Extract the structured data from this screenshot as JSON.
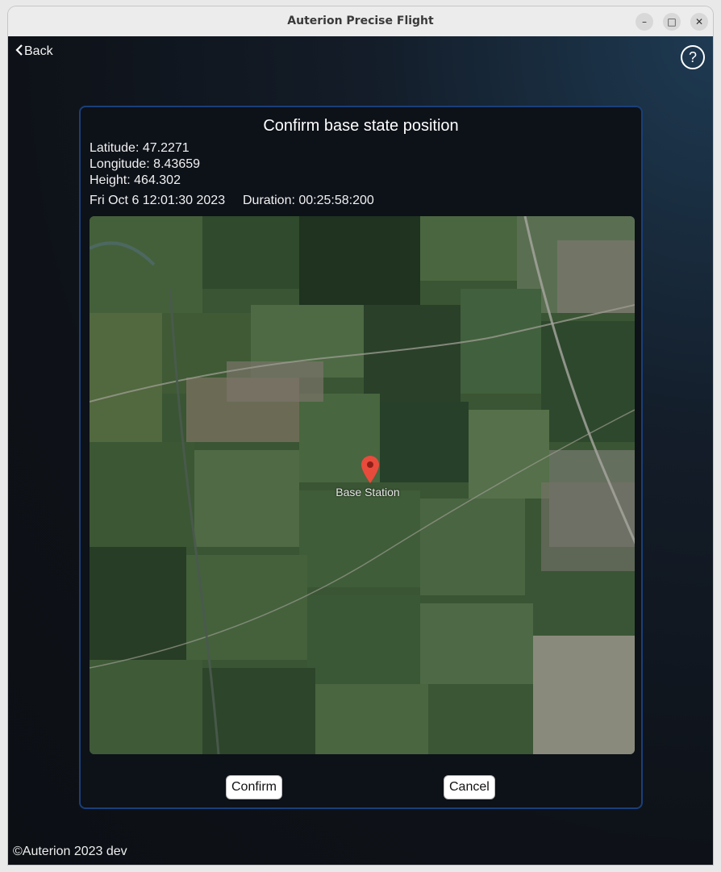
{
  "window": {
    "title": "Auterion Precise Flight",
    "minimize_icon": "minimize-icon",
    "maximize_icon": "maximize-icon",
    "close_icon": "close-icon"
  },
  "header": {
    "back_label": "Back",
    "back_chevron": "‹",
    "help_label": "?"
  },
  "dialog": {
    "title": "Confirm base state position",
    "latitude": "Latitude: 47.2271",
    "longitude": "Longitude: 8.43659",
    "height": "Height: 464.302",
    "timestamp": "Fri Oct 6 12:01:30 2023",
    "duration": "Duration: 00:25:58:200",
    "marker_label": "Base Station",
    "confirm_label": "Confirm",
    "cancel_label": "Cancel"
  },
  "footer": {
    "text": "©Auterion 2023 dev"
  },
  "colors": {
    "dialog_border": "#1a3f7a",
    "marker": "#e84b3c",
    "button_bg": "#ffffff"
  }
}
